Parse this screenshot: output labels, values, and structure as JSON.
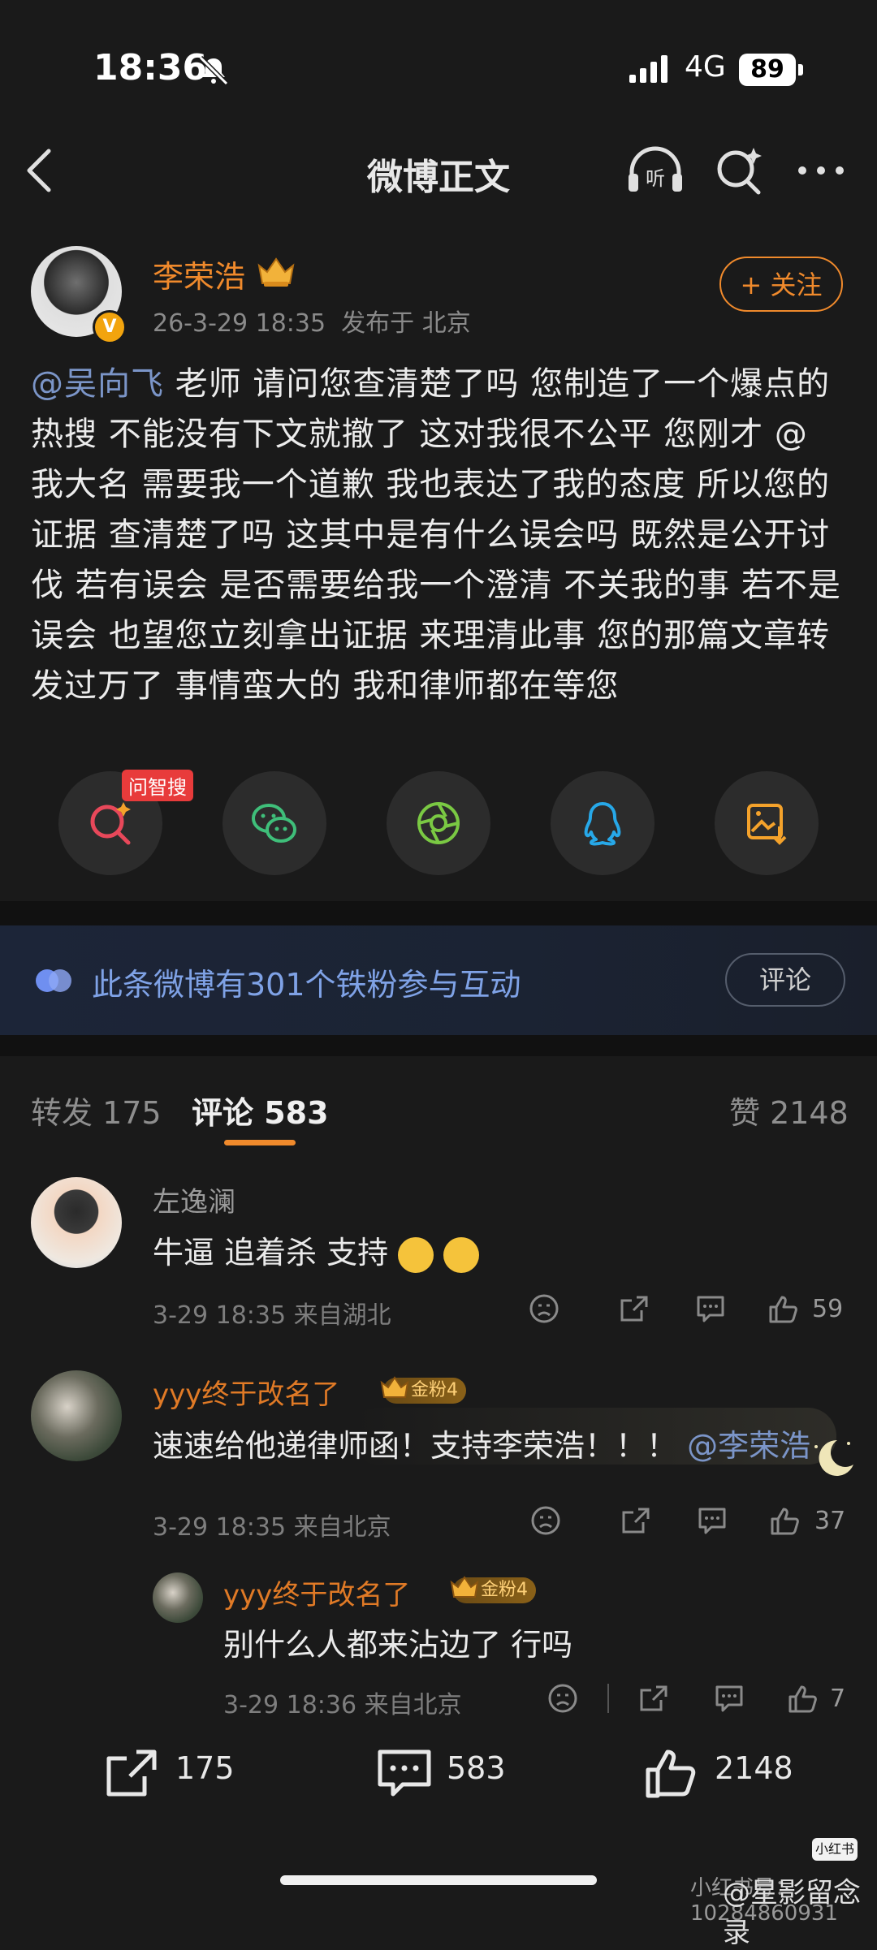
{
  "status": {
    "time": "18:36",
    "network": "4G",
    "battery": "89"
  },
  "nav": {
    "title": "微博正文"
  },
  "post": {
    "username": "李荣浩",
    "time": "26-3-29 18:35",
    "location": "发布于 北京",
    "follow_label": "+ 关注",
    "mention": "@吴向飞",
    "text": " 老师 请问您查清楚了吗 您制造了一个爆点的热搜 不能没有下文就撤了 这对我很不公平 您刚才 @ 我大名 需要我一个道歉 我也表达了我的态度 所以您的证据 查清楚了吗 这其中是有什么误会吗 既然是公开讨伐 若有误会 是否需要给我一个澄清 不关我的事 若不是误会 也望您立刻拿出证据 来理清此事 您的那篇文章转发过万了 事情蛮大的 我和律师都在等您"
  },
  "share": {
    "tag": "问智搜"
  },
  "fans": {
    "text": "此条微博有301个铁粉参与互动",
    "button": "评论"
  },
  "tabs": {
    "repost": "转发 175",
    "comment": "评论 583",
    "like": "赞 2148"
  },
  "comments": [
    {
      "name": "左逸澜",
      "text": "牛逼 追着杀 支持",
      "meta": "3-29 18:35 来自湖北",
      "likes": "59"
    },
    {
      "name": "yyy终于改名了",
      "badge": "金粉4",
      "text": "速速给他递律师函！支持李荣浩！！！",
      "mention": "@李荣浩",
      "meta": "3-29 18:35 来自北京",
      "likes": "37"
    },
    {
      "name": "yyy终于改名了",
      "badge": "金粉4",
      "text": "别什么人都来沾边了 行吗",
      "meta": "3-29 18:36 来自北京",
      "likes": "7"
    }
  ],
  "bottom": {
    "repost": "175",
    "comment": "583",
    "like": "2148"
  },
  "watermark": {
    "logo": "小红书",
    "id": "小红书号：10284860931",
    "name": "@星影留念录"
  },
  "colors": {
    "accent": "#f08a2c",
    "link": "#7b95c8",
    "background": "#1a1a1a"
  }
}
